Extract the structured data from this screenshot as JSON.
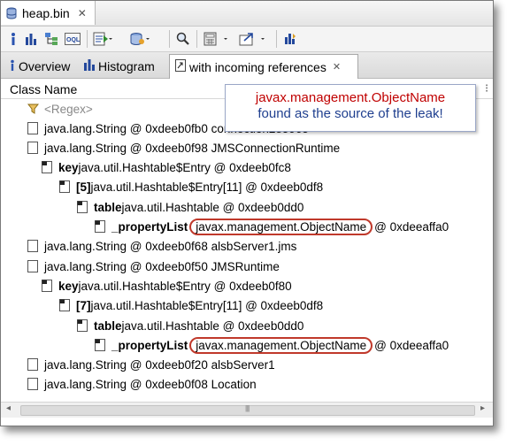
{
  "window": {
    "file_tab": "heap.bin"
  },
  "tabs": [
    {
      "label": "Overview"
    },
    {
      "label": "Histogram"
    },
    {
      "label": "with incoming references"
    }
  ],
  "table": {
    "column": "Class Name",
    "regex_placeholder": "<Regex>"
  },
  "rows": [
    {
      "text": "java.lang.String @ 0xdeeb0fb0  connection285965"
    },
    {
      "text": "java.lang.String @ 0xdeeb0f98  JMSConnectionRuntime"
    },
    {
      "bold": "key",
      "text": " java.util.Hashtable$Entry @ 0xdeeb0fc8"
    },
    {
      "bold": "[5]",
      "text": " java.util.Hashtable$Entry[11] @ 0xdeeb0df8"
    },
    {
      "bold": "table",
      "text": " java.util.Hashtable @ 0xdeeb0dd0"
    },
    {
      "bold": "_propertyList",
      "hl": "javax.management.ObjectName",
      "text": " @ 0xdeeaffa0"
    },
    {
      "text": "java.lang.String @ 0xdeeb0f68  alsbServer1.jms"
    },
    {
      "text": "java.lang.String @ 0xdeeb0f50  JMSRuntime"
    },
    {
      "bold": "key",
      "text": " java.util.Hashtable$Entry @ 0xdeeb0f80"
    },
    {
      "bold": "[7]",
      "text": " java.util.Hashtable$Entry[11] @ 0xdeeb0df8"
    },
    {
      "bold": "table",
      "text": " java.util.Hashtable @ 0xdeeb0dd0"
    },
    {
      "bold": "_propertyList",
      "hl": "javax.management.ObjectName",
      "text": " @ 0xdeeaffa0"
    },
    {
      "text": "java.lang.String @ 0xdeeb0f20  alsbServer1"
    },
    {
      "text": "java.lang.String @ 0xdeeb0f08  Location"
    }
  ],
  "callout": {
    "line1": "javax.management.ObjectName",
    "line2": "found as the source of the leak!"
  },
  "colors": {
    "highlight": "#c0392b",
    "callout_red": "#c00000",
    "callout_blue": "#1f3f8f"
  },
  "icons": [
    "database-icon",
    "info-icon",
    "histogram-icon",
    "dominator-tree-icon",
    "oql-icon",
    "run-report-icon",
    "heap-dump-icon",
    "search-icon",
    "calculator-icon",
    "export-icon",
    "pin-icon"
  ]
}
